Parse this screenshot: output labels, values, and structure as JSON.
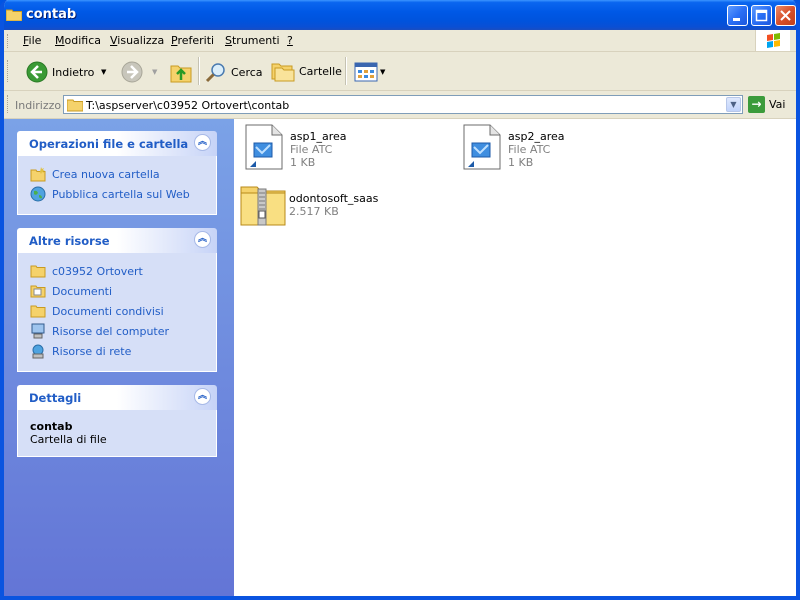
{
  "window": {
    "title": "contab"
  },
  "menu": [
    {
      "u": "F",
      "rest": "ile"
    },
    {
      "u": "M",
      "rest": "odifica"
    },
    {
      "u": "V",
      "rest": "isualizza"
    },
    {
      "u": "P",
      "rest": "referiti"
    },
    {
      "u": "S",
      "rest": "trumenti"
    },
    {
      "u": "?",
      "rest": ""
    }
  ],
  "toolbar": {
    "back_label": "Indietro",
    "search_label": "Cerca",
    "folders_label": "Cartelle"
  },
  "address": {
    "label": "Indirizzo",
    "path": "T:\\aspserver\\c03952 Ortovert\\contab",
    "go_label": "Vai"
  },
  "panels": {
    "file_ops": {
      "title": "Operazioni file e cartella",
      "items": [
        "Crea nuova cartella",
        "Pubblica cartella sul Web"
      ]
    },
    "other": {
      "title": "Altre risorse",
      "items": [
        "c03952 Ortovert",
        "Documenti",
        "Documenti condivisi",
        "Risorse del computer",
        "Risorse di rete"
      ]
    },
    "details": {
      "title": "Dettagli",
      "name": "contab",
      "type": "Cartella di file"
    }
  },
  "files": [
    {
      "name": "asp1_area",
      "type": "File ATC",
      "size": "1 KB",
      "icon": "atc-file-icon"
    },
    {
      "name": "asp2_area",
      "type": "File ATC",
      "size": "1 KB",
      "icon": "atc-file-icon"
    },
    {
      "name": "odontosoft_saas",
      "type": "",
      "size": "2.517 KB",
      "icon": "zip-folder-icon"
    }
  ],
  "colors": {
    "title_bar": "#0054e3",
    "sidebar_top": "#7ba2e7",
    "sidebar_bottom": "#6375d6",
    "link": "#215dc6"
  }
}
